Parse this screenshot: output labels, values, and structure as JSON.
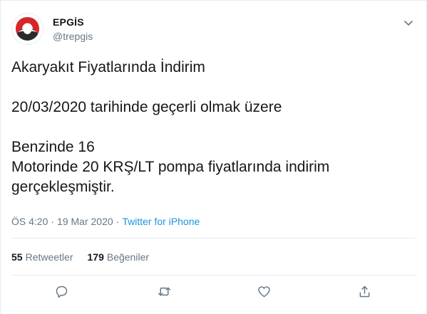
{
  "tweet": {
    "author_name": "EPGİS",
    "author_handle": "@trepgis",
    "text": "Akaryakıt Fiyatlarında İndirim\n\n20/03/2020  tarihinde geçerli olmak üzere\n\nBenzinde 16\nMotorinde 20 KRŞ/LT pompa fiyatlarında indirim\ngerçekleşmiştir.",
    "time": "ÖS 4:20",
    "date": "19 Mar 2020",
    "source": "Twitter for iPhone",
    "retweets_count": "55",
    "retweets_label": "Retweetler",
    "likes_count": "179",
    "likes_label": "Beğeniler"
  },
  "icons": {
    "caret": "chevron-down-icon",
    "reply": "reply-icon",
    "retweet": "retweet-icon",
    "like": "heart-icon",
    "share": "share-icon"
  },
  "colors": {
    "text": "#14171a",
    "secondary": "#657786",
    "link": "#1b95e0",
    "divider": "#e6ecf0",
    "logo_red": "#d7262b",
    "logo_dark": "#2b2b2b"
  }
}
